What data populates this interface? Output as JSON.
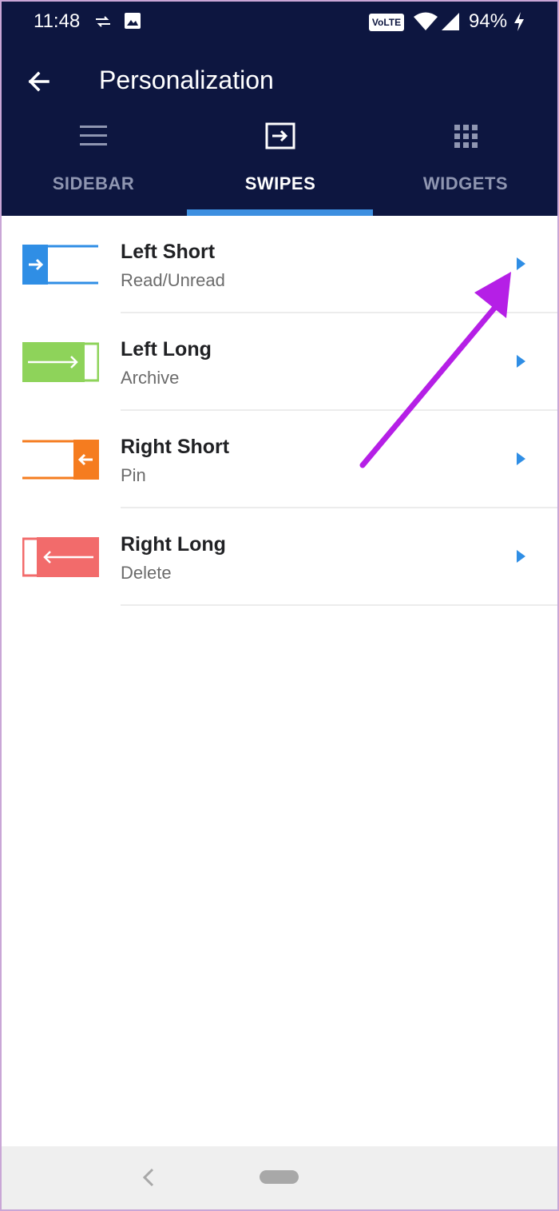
{
  "status": {
    "time": "11:48",
    "volte": "VoLTE",
    "battery": "94%"
  },
  "appbar": {
    "title": "Personalization"
  },
  "tabs": [
    {
      "label": "SIDEBAR",
      "icon": "menu-icon",
      "active": false
    },
    {
      "label": "SWIPES",
      "icon": "swipe-icon",
      "active": true
    },
    {
      "label": "WIDGETS",
      "icon": "grid-icon",
      "active": false
    }
  ],
  "swipes": [
    {
      "title": "Left Short",
      "action": "Read/Unread",
      "color": "#2f8ee5"
    },
    {
      "title": "Left Long",
      "action": "Archive",
      "color": "#8ed35a"
    },
    {
      "title": "Right Short",
      "action": "Pin",
      "color": "#f57c1f"
    },
    {
      "title": "Right Long",
      "action": "Delete",
      "color": "#f26b6b"
    }
  ],
  "colors": {
    "appbar": "#0d1640",
    "accent": "#3d8fe0",
    "annotation": "#b51fe6"
  }
}
